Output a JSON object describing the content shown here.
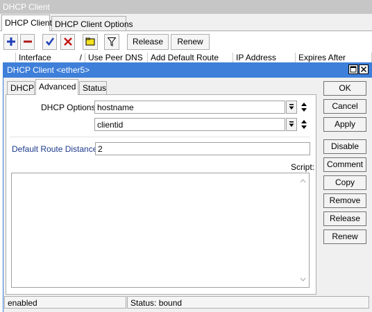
{
  "outer_window": {
    "title": "DHCP Client",
    "tabs": [
      {
        "label": "DHCP Client",
        "active": true
      },
      {
        "label": "DHCP Client Options",
        "active": false
      }
    ],
    "toolbar": {
      "add_icon": "plus-icon",
      "remove_icon": "minus-icon",
      "enable_icon": "check-icon",
      "disable_icon": "x-icon",
      "comment_icon": "note-icon",
      "filter_icon": "filter-icon",
      "release_label": "Release",
      "renew_label": "Renew"
    },
    "columns": [
      "Interface",
      "Use Peer DNS",
      "Add Default Route",
      "IP Address",
      "Expires After"
    ],
    "column_sort_mark": "/"
  },
  "dialog": {
    "title": "DHCP Client <ether5>",
    "window_buttons": {
      "maximize": "maximize-icon",
      "close": "close-icon"
    },
    "tabs": [
      {
        "label": "DHCP",
        "active": false
      },
      {
        "label": "Advanced",
        "active": true
      },
      {
        "label": "Status",
        "active": false
      }
    ],
    "fields": {
      "dhcp_options_label": "DHCP Options:",
      "dhcp_options": [
        "hostname",
        "clientid"
      ],
      "default_route_distance_label": "Default Route Distance:",
      "default_route_distance": "2",
      "script_label": "Script:",
      "script_value": ""
    },
    "buttons": {
      "ok": "OK",
      "cancel": "Cancel",
      "apply": "Apply",
      "disable": "Disable",
      "comment": "Comment",
      "copy": "Copy",
      "remove": "Remove",
      "release": "Release",
      "renew": "Renew"
    },
    "status_bar": {
      "left": "enabled",
      "right": "Status: bound"
    }
  },
  "colors": {
    "dialog_title_bg": "#3e7fd9",
    "add_icon": "#1e3fb8",
    "remove_icon": "#b01818",
    "check_icon": "#1e3fb8",
    "x_icon": "#c41818",
    "note_icon": "#f2e020",
    "label_highlight": "#1c3a8c"
  }
}
